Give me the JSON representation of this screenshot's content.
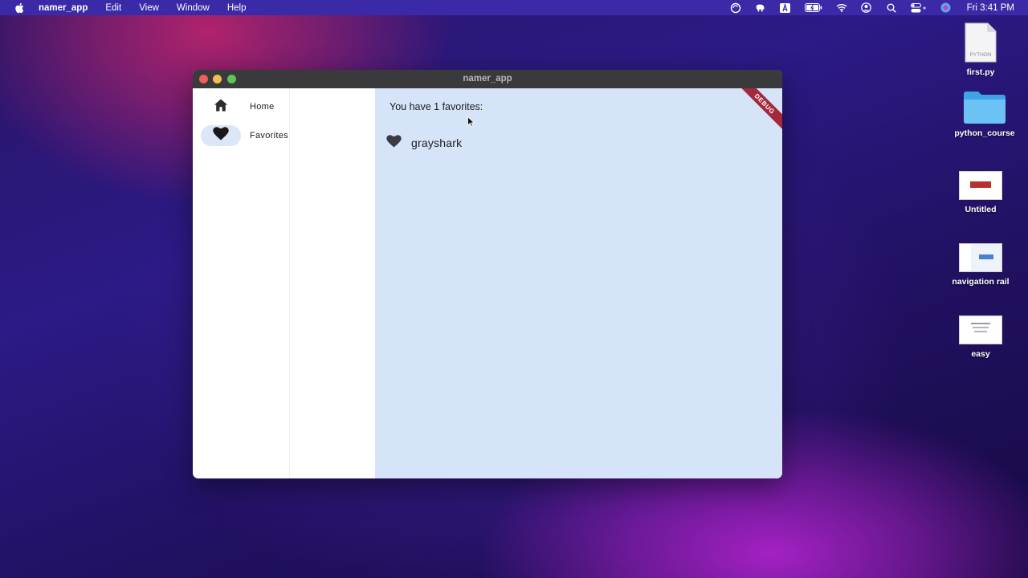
{
  "menubar": {
    "apple_icon": "apple-icon",
    "app_name": "namer_app",
    "menus": [
      "Edit",
      "View",
      "Window",
      "Help"
    ],
    "clock": "Fri 3:41 PM"
  },
  "window": {
    "title": "namer_app",
    "debug_banner": "DEBUG"
  },
  "rail": {
    "items": [
      {
        "label": "Home",
        "icon": "home-icon",
        "selected": false
      },
      {
        "label": "Favorites",
        "icon": "heart-icon",
        "selected": true
      }
    ]
  },
  "main": {
    "count_text": "You have 1 favorites:",
    "favorites": [
      {
        "icon": "heart-icon",
        "name": "grayshark"
      }
    ]
  },
  "desktop": {
    "icons": [
      {
        "label": "first.py",
        "badge": "PYTHON",
        "kind": "file"
      },
      {
        "label": "python_course",
        "kind": "folder"
      },
      {
        "label": "Untitled",
        "kind": "screenshot"
      },
      {
        "label": "navigation rail",
        "kind": "screenshot"
      },
      {
        "label": "easy",
        "kind": "screenshot"
      }
    ]
  },
  "colors": {
    "rail_indicator": "#dbe6f7",
    "main_background": "#d5e4f8",
    "debug_banner": "#a3283b"
  }
}
